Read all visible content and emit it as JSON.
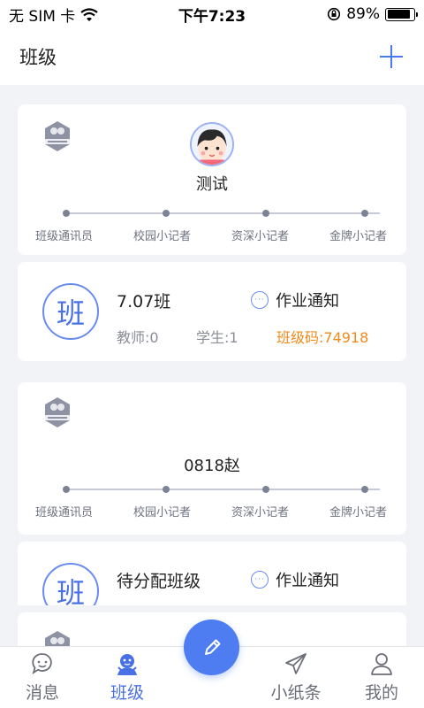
{
  "status_bar": {
    "carrier": "无 SIM 卡",
    "time": "下午7:23",
    "battery": "89%",
    "battery_level": 0.89
  },
  "header": {
    "title": "班级"
  },
  "levels": [
    "班级通讯员",
    "校园小记者",
    "资深小记者",
    "金牌小记者"
  ],
  "cards": [
    {
      "type": "member",
      "name": "测试"
    },
    {
      "type": "class",
      "icon_char": "班",
      "name": "7.07班",
      "homework": "作业通知",
      "teachers": "教师:0",
      "students": "学生:1",
      "class_code": "班级码:74918"
    },
    {
      "type": "member",
      "name": "0818赵"
    },
    {
      "type": "class",
      "icon_char": "班",
      "name": "待分配班级",
      "homework": "作业通知"
    }
  ],
  "tabs": [
    {
      "label": "消息",
      "icon": "chat-bubble-icon"
    },
    {
      "label": "班级",
      "icon": "class-icon"
    },
    {
      "label": "小纸条",
      "icon": "paper-plane-icon"
    },
    {
      "label": "我的",
      "icon": "user-icon"
    }
  ],
  "fab_icon": "pencil-icon",
  "colors": {
    "accent": "#4a70e6",
    "orange": "#f08a1c"
  }
}
